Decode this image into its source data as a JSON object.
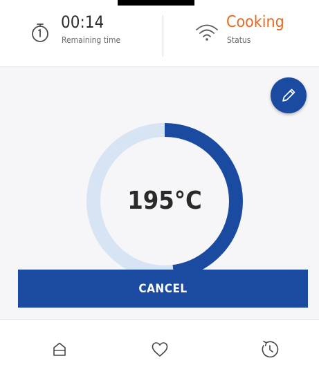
{
  "header": {
    "timer": {
      "value": "00:14",
      "label": "Remaining time",
      "icon": "stopwatch-icon"
    },
    "status": {
      "value": "Cooking",
      "label": "Status",
      "icon": "wifi-icon",
      "color": "#e56a23"
    }
  },
  "main": {
    "temperature": "195°C",
    "progress_fraction": 0.48,
    "edit_icon": "pencil-icon",
    "cancel_label": "CANCEL"
  },
  "colors": {
    "accent": "#1a4ba0",
    "ring_track": "#d6e4f3",
    "status": "#e56a23"
  },
  "bottom_nav": [
    {
      "name": "home",
      "icon": "home-icon"
    },
    {
      "name": "favorites",
      "icon": "heart-icon"
    },
    {
      "name": "history",
      "icon": "history-icon"
    }
  ]
}
